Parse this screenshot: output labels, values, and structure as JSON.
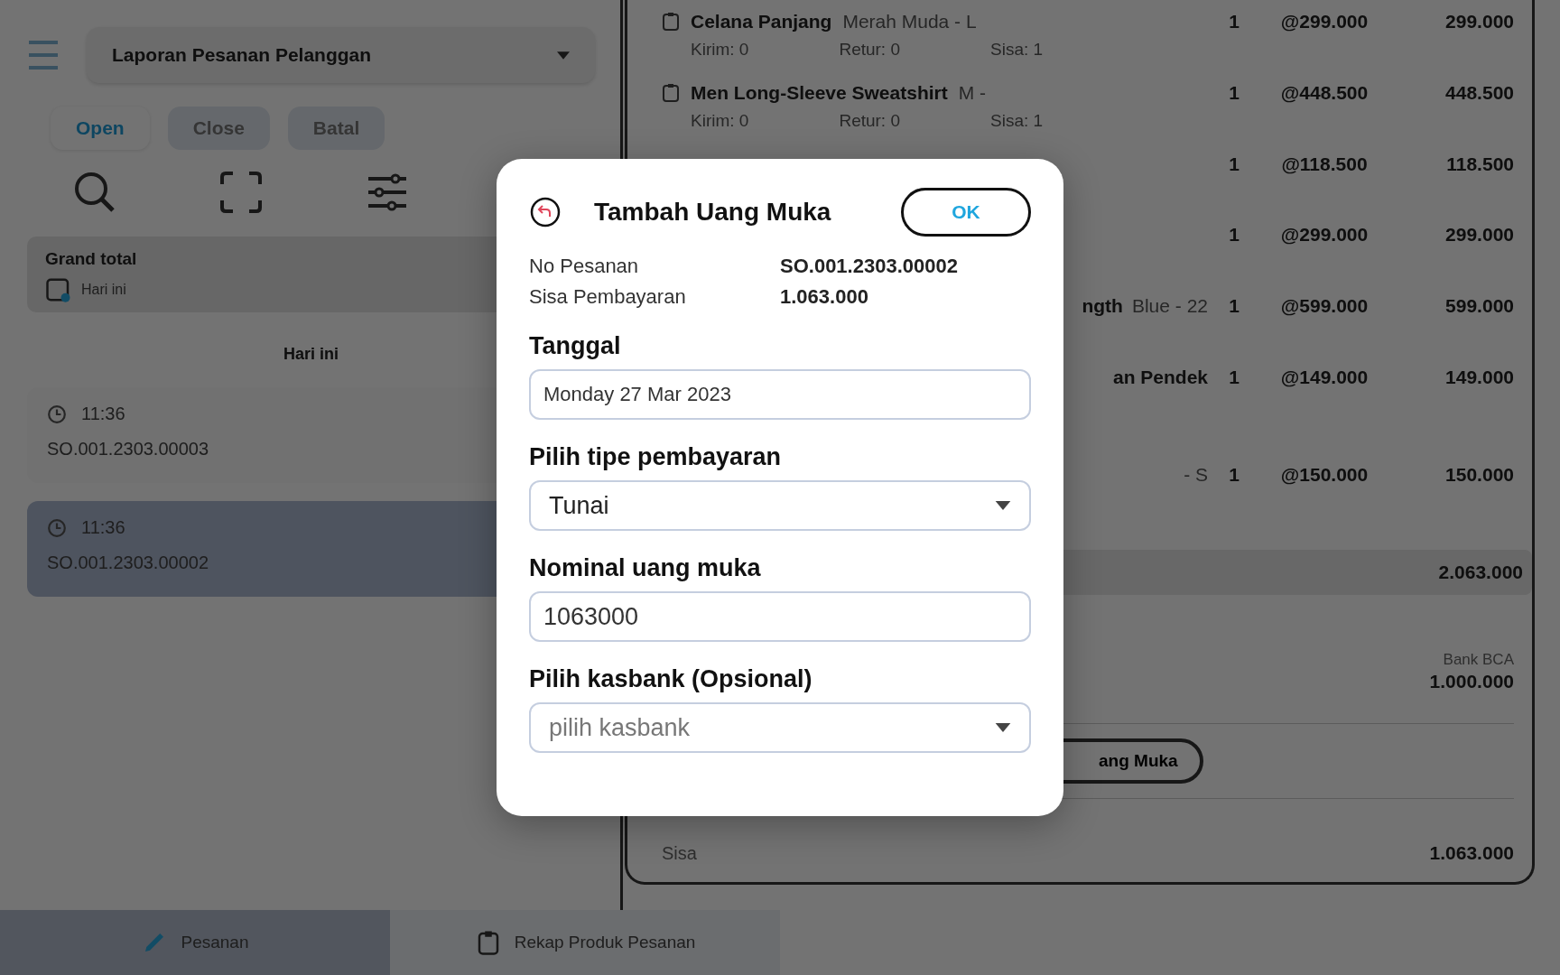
{
  "app_bar": {
    "report_select": "Laporan Pesanan Pelanggan"
  },
  "status_tabs": [
    {
      "label": "Open",
      "selected": true
    },
    {
      "label": "Close",
      "selected": false
    },
    {
      "label": "Batal",
      "selected": false
    }
  ],
  "grand_total": {
    "label": "Grand total",
    "period": "Hari ini"
  },
  "orders_section": {
    "heading": "Hari ini",
    "orders": [
      {
        "time": "11:36",
        "number": "SO.001.2303.00003",
        "selected": false
      },
      {
        "time": "11:36",
        "number": "SO.001.2303.00002",
        "selected": true
      }
    ]
  },
  "order_detail": {
    "items": [
      {
        "name": "Celana Panjang",
        "variant": "Merah Muda - L",
        "sent": "Kirim: 0",
        "returned": "Retur: 0",
        "remaining": "Sisa: 1",
        "qty": "1",
        "price": "@299.000",
        "subtotal": "299.000"
      },
      {
        "name": "Men Long-Sleeve Sweatshirt",
        "variant": "M -",
        "sent": "Kirim: 0",
        "returned": "Retur: 0",
        "remaining": "Sisa: 1",
        "qty": "1",
        "price": "@448.500",
        "subtotal": "448.500"
      },
      {
        "qty": "1",
        "price": "@118.500",
        "subtotal": "118.500"
      },
      {
        "qty": "1",
        "price": "@299.000",
        "subtotal": "299.000"
      },
      {
        "name": "ngth",
        "variant": "Blue - 22",
        "qty": "1",
        "price": "@599.000",
        "subtotal": "599.000"
      },
      {
        "name": "an Pendek",
        "qty": "1",
        "price": "@149.000",
        "subtotal": "149.000"
      },
      {
        "variant": "- S",
        "qty": "1",
        "price": "@150.000",
        "subtotal": "150.000"
      }
    ],
    "total": "2.063.000",
    "payments": [
      {
        "account": "Bank BCA",
        "amount": "1.000.000"
      }
    ],
    "add_button": "ang Muka",
    "remaining_label": "Sisa",
    "remaining_value": "1.063.000"
  },
  "bottom_nav": [
    {
      "label": "Pesanan",
      "selected": true
    },
    {
      "label": "Rekap Produk Pesanan",
      "selected": false
    }
  ],
  "dialog": {
    "title": "Tambah Uang Muka",
    "ok_button": "OK",
    "info": [
      {
        "label": "No Pesanan",
        "value": "SO.001.2303.00002"
      },
      {
        "label": "Sisa Pembayaran",
        "value": "1.063.000"
      }
    ],
    "fields": [
      {
        "kind": "date",
        "label": "Tanggal",
        "value": "Monday 27 Mar 2023"
      },
      {
        "kind": "select",
        "label": "Pilih tipe pembayaran",
        "value": "Tunai"
      },
      {
        "kind": "input",
        "label": "Nominal uang muka",
        "value": "1063000"
      },
      {
        "kind": "select",
        "label": "Pilih kasbank (Opsional)",
        "placeholder": "pilih kasbank"
      }
    ]
  }
}
